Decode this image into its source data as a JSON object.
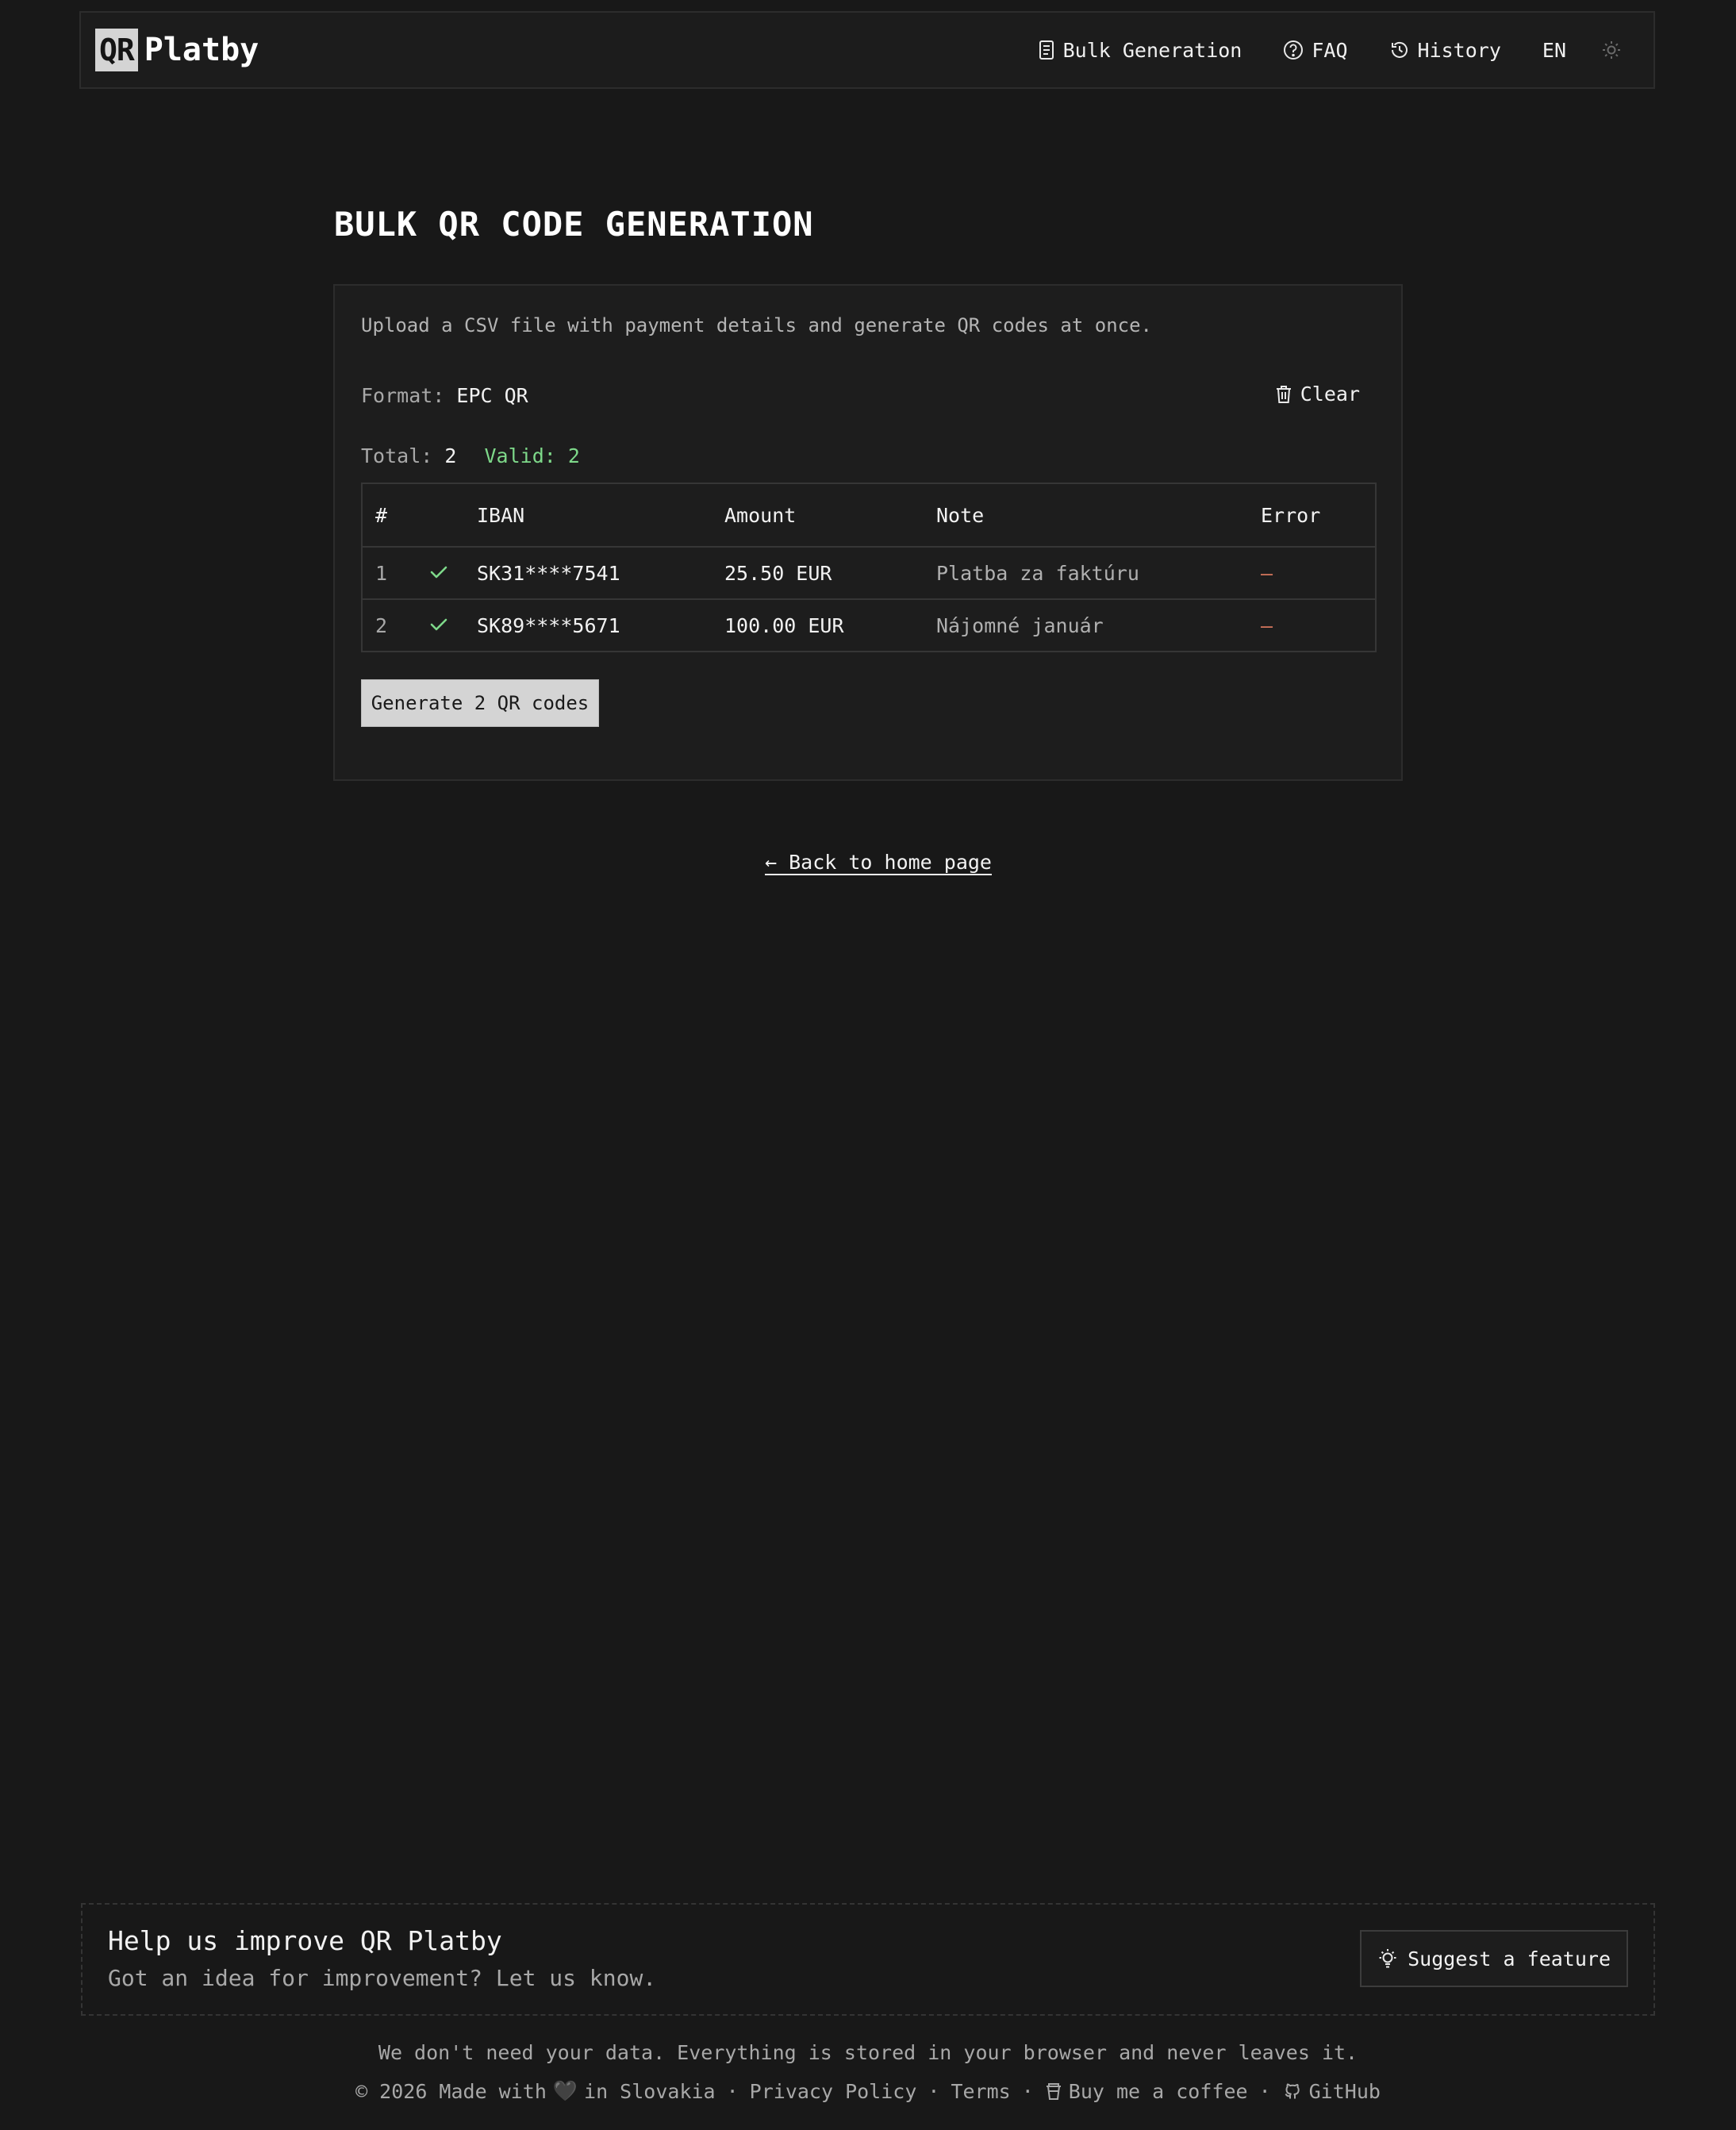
{
  "header": {
    "logo_box": "QR",
    "logo_text": "Platby",
    "nav": {
      "bulk": "Bulk Generation",
      "faq": "FAQ",
      "history": "History",
      "lang": "EN"
    }
  },
  "main": {
    "title": "BULK QR CODE GENERATION",
    "description": "Upload a CSV file with payment details and generate QR codes at once.",
    "format_label": "Format:",
    "format_value": "EPC QR",
    "clear_label": "Clear",
    "total_label": "Total:",
    "total_value": "2",
    "valid_text": "Valid: 2",
    "table": {
      "headers": [
        "#",
        "",
        "IBAN",
        "Amount",
        "Note",
        "Error"
      ],
      "rows": [
        {
          "index": "1",
          "status": "valid",
          "iban": "SK31****7541",
          "amount": "25.50 EUR",
          "note": "Platba za faktúru",
          "error": "—"
        },
        {
          "index": "2",
          "status": "valid",
          "iban": "SK89****5671",
          "amount": "100.00 EUR",
          "note": "Nájomné január",
          "error": "—"
        }
      ]
    },
    "generate_label": "Generate 2 QR codes",
    "back_label": "← Back to home page"
  },
  "footer": {
    "improve_title": "Help us improve QR Platby",
    "improve_sub": "Got an idea for improvement? Let us know.",
    "suggest_label": "Suggest a feature",
    "privacy_note": "We don't need your data. Everything is stored in your browser and never leaves it.",
    "copyright_pre": "© 2026 Made with",
    "copyright_post": "in Slovakia",
    "heart": "🖤",
    "privacy_link": "Privacy Policy",
    "terms_link": "Terms",
    "coffee_link": "Buy me a coffee",
    "github_link": "GitHub",
    "separator": "·"
  },
  "colors": {
    "background": "#181818",
    "card": "#1d1d1d",
    "valid": "#7ed98a",
    "error": "#d9785e",
    "button": "#d4d4d4"
  },
  "icons": {
    "bulk": "document-icon",
    "faq": "question-circle-icon",
    "history": "history-icon",
    "theme": "sun-icon",
    "clear": "trash-icon",
    "status": "check-icon",
    "suggest": "lightbulb-icon",
    "coffee": "coffee-cup-icon",
    "github": "github-icon"
  }
}
